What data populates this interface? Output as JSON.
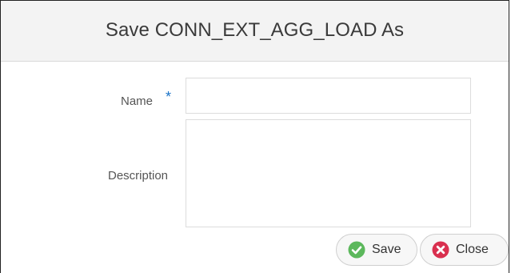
{
  "dialog": {
    "title": "Save CONN_EXT_AGG_LOAD As"
  },
  "form": {
    "name_label": "Name",
    "required_marker": "*",
    "name_value": "",
    "description_label": "Description",
    "description_value": ""
  },
  "buttons": {
    "save_label": "Save",
    "close_label": "Close"
  },
  "colors": {
    "save_icon": "#5cb85c",
    "close_icon": "#d9304f",
    "required": "#1a73c8"
  }
}
